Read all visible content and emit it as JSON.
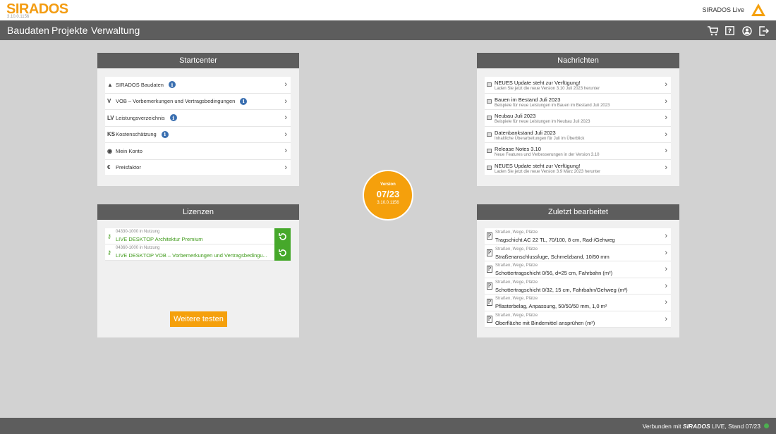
{
  "header": {
    "logo": "SIRADOS",
    "version_small": "3.10.0.1156",
    "brand_label": "SIRADOS Live",
    "brand_icon": "sirados-triangle-icon"
  },
  "nav": {
    "items": [
      "Baudaten",
      "Projekte",
      "Verwaltung"
    ],
    "icons": [
      "cart-icon",
      "help-icon",
      "user-icon",
      "logout-icon"
    ]
  },
  "startcenter": {
    "title": "Startcenter",
    "items": [
      {
        "prefix": "▲",
        "label": "SIRADOS Baudaten",
        "info": true
      },
      {
        "prefix": "V",
        "label": "VOB – Vorbemerkungen und Vertragsbedingungen",
        "info": true
      },
      {
        "prefix": "LV",
        "label": "Leistungsverzeichnis",
        "info": true
      },
      {
        "prefix": "KS",
        "label": "Kostenschätzung",
        "info": true
      },
      {
        "prefix": "◉",
        "label": "Mein Konto",
        "info": false
      },
      {
        "prefix": "€",
        "label": "Preisfaktor",
        "info": false
      }
    ]
  },
  "news": {
    "title": "Nachrichten",
    "items": [
      {
        "title": "NEUES Update steht zur Verfügung!",
        "sub": "Laden Sie jetzt die neue Version 3.10 Juli 2023 herunter"
      },
      {
        "title": "Bauen im Bestand Juli 2023",
        "sub": "Beispiele für neue Leistungen im Bauen im Bestand Juli 2023"
      },
      {
        "title": "Neubau Juli 2023",
        "sub": "Beispiele für neue Leistungen im Neubau Juli 2023"
      },
      {
        "title": "Datenbankstand Juli 2023",
        "sub": "Inhaltliche Überarbeitungen für Juli im Überblick"
      },
      {
        "title": "Release Notes 3.10",
        "sub": "Neue Features und Verbesserungen in der Version 3.10"
      },
      {
        "title": "NEUES Update steht zur Verfügung!",
        "sub": "Laden Sie jetzt die neue Version 3.9 März 2023 herunter"
      }
    ]
  },
  "licenses": {
    "title": "Lizenzen",
    "items": [
      {
        "code": "04330-1000 in Nutzung",
        "name": "LIVE DESKTOP Architektur Premium"
      },
      {
        "code": "04360-1000 in Nutzung",
        "name": "LIVE DESKTOP VOB – Vorbemerkungen und Vertragsbedingu..."
      }
    ],
    "button": "Weitere testen"
  },
  "version": {
    "label": "Version",
    "number": "07/23",
    "build": "3.10.0.1156"
  },
  "recent": {
    "title": "Zuletzt bearbeitet",
    "items": [
      {
        "category": "Straßen, Wege, Plätze",
        "title": "Tragschicht AC 22 TL, 70/100, 8 cm, Rad-/Gehweg"
      },
      {
        "category": "Straßen, Wege, Plätze",
        "title": "Straßenanschlussfuge, Schmelzband, 10/50 mm"
      },
      {
        "category": "Straßen, Wege, Plätze",
        "title": "Schottertragschicht 0/56, d=25 cm, Fahrbahn (m²)"
      },
      {
        "category": "Straßen, Wege, Plätze",
        "title": "Schottertragschicht 0/32, 15 cm, Fahrbahn/Gehweg (m²)"
      },
      {
        "category": "Straßen, Wege, Plätze",
        "title": "Pflasterbelag, Anpassung, 50/50/50 mm, 1,0 m²"
      },
      {
        "category": "Straßen, Wege, Plätze",
        "title": "Oberfläche mit Bindemittel ansprühen (m²)"
      }
    ]
  },
  "footer": {
    "prefix": "Verbunden mit ",
    "logo": "SIRADOS",
    "suffix": " LIVE, Stand 07/23",
    "status_color": "#4caf50"
  }
}
